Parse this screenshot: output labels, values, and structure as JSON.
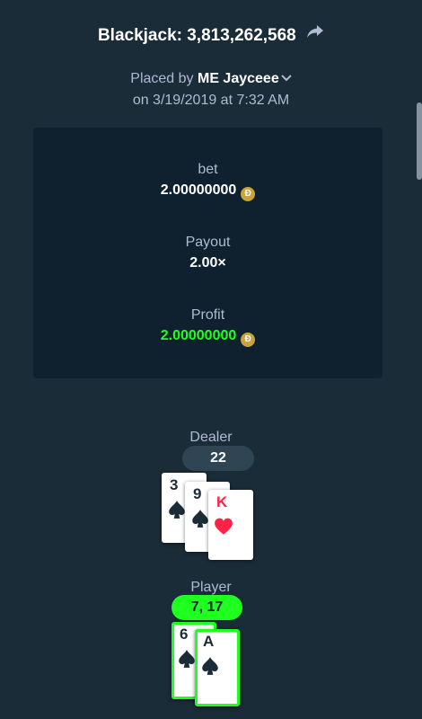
{
  "bet_title": "Blackjack: 3,813,262,568",
  "placed_prefix": "Placed by",
  "user": "ME Jayceee",
  "date_line": "on 3/19/2019 at 7:32 AM",
  "bet": {
    "label": "bet",
    "value": "2.00000000"
  },
  "payout": {
    "label": "Payout",
    "value": "2.00×"
  },
  "profit": {
    "label": "Profit",
    "value": "2.00000000"
  },
  "currency_symbol": "Ð",
  "dealer": {
    "label": "Dealer",
    "score": "22",
    "cards": [
      {
        "rank": "3",
        "suit": "spade"
      },
      {
        "rank": "9",
        "suit": "spade"
      },
      {
        "rank": "K",
        "suit": "heart"
      }
    ]
  },
  "player": {
    "label": "Player",
    "score": "7, 17",
    "cards": [
      {
        "rank": "6",
        "suit": "spade"
      },
      {
        "rank": "A",
        "suit": "spade"
      }
    ]
  },
  "colors": {
    "background": "#1a2c38",
    "panel": "#0f212e",
    "win": "#1fff20",
    "muted": "#b1bad3",
    "red_suit": "#fe2247",
    "coin": "#c9a43a"
  },
  "icons": [
    "share-icon",
    "chevron-down-icon",
    "dogecoin-icon",
    "spade-icon",
    "heart-icon"
  ]
}
